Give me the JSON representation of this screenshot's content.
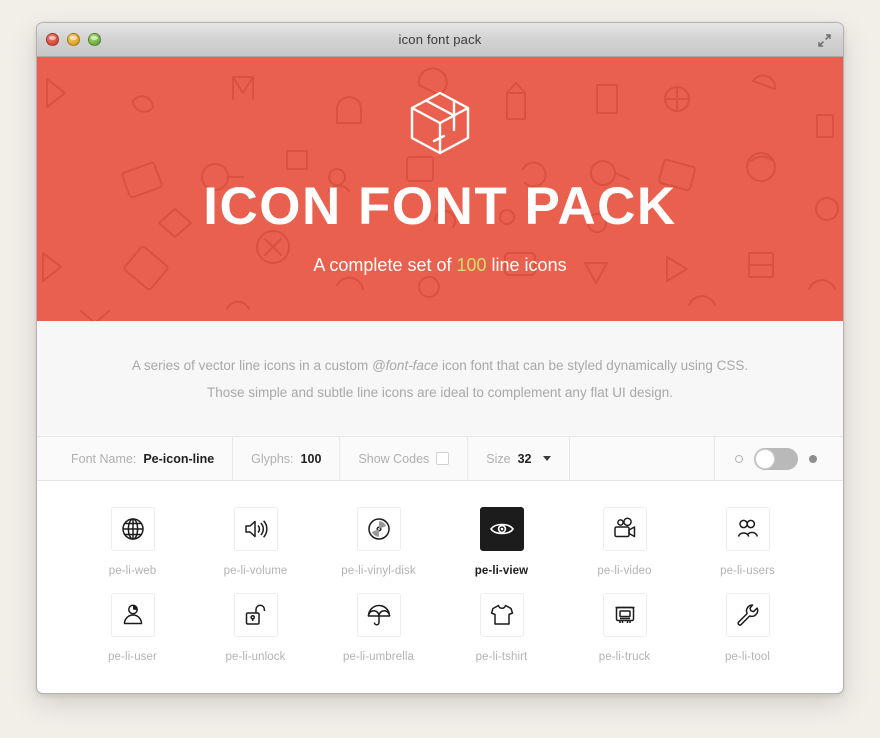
{
  "window": {
    "title": "icon font pack",
    "traffic_lights": [
      "close-red",
      "minimize-yellow",
      "zoom-green"
    ],
    "expand_icon": "fullscreen-expand-icon"
  },
  "hero": {
    "logo_icon": "package-box-icon",
    "title": "ICON FONT PACK",
    "subtitle_before": "A complete set of ",
    "subtitle_count": "100",
    "subtitle_after": " line icons",
    "background_color": "#e9604e",
    "count_color": "#cfe06a"
  },
  "description": {
    "line1_part1": "A series of vector line icons in a custom ",
    "line1_em": "@font-face",
    "line1_part2": " icon font that can be styled dynamically using CSS.",
    "line2": "Those simple and subtle line icons are ideal to complement any flat UI design."
  },
  "toolbar": {
    "font_name_label": "Font Name:",
    "font_name_value": "Pe-icon-line",
    "glyphs_label": "Glyphs:",
    "glyphs_value": "100",
    "show_codes_label": "Show Codes",
    "show_codes_checked": false,
    "size_label": "Size",
    "size_value": "32",
    "toggle_state": "off"
  },
  "grid": {
    "icons": [
      {
        "name": "pe-li-web",
        "icon": "globe-icon",
        "selected": false
      },
      {
        "name": "pe-li-volume",
        "icon": "speaker-icon",
        "selected": false
      },
      {
        "name": "pe-li-vinyl-disk",
        "icon": "vinyl-disk-icon",
        "selected": false
      },
      {
        "name": "pe-li-view",
        "icon": "eye-icon",
        "selected": true
      },
      {
        "name": "pe-li-video",
        "icon": "video-camera-icon",
        "selected": false
      },
      {
        "name": "pe-li-users",
        "icon": "users-icon",
        "selected": false
      },
      {
        "name": "pe-li-user",
        "icon": "user-icon",
        "selected": false
      },
      {
        "name": "pe-li-unlock",
        "icon": "unlock-icon",
        "selected": false
      },
      {
        "name": "pe-li-umbrella",
        "icon": "umbrella-icon",
        "selected": false
      },
      {
        "name": "pe-li-tshirt",
        "icon": "tshirt-icon",
        "selected": false
      },
      {
        "name": "pe-li-truck",
        "icon": "truck-icon",
        "selected": false
      },
      {
        "name": "pe-li-tool",
        "icon": "wrench-icon",
        "selected": false
      }
    ]
  }
}
